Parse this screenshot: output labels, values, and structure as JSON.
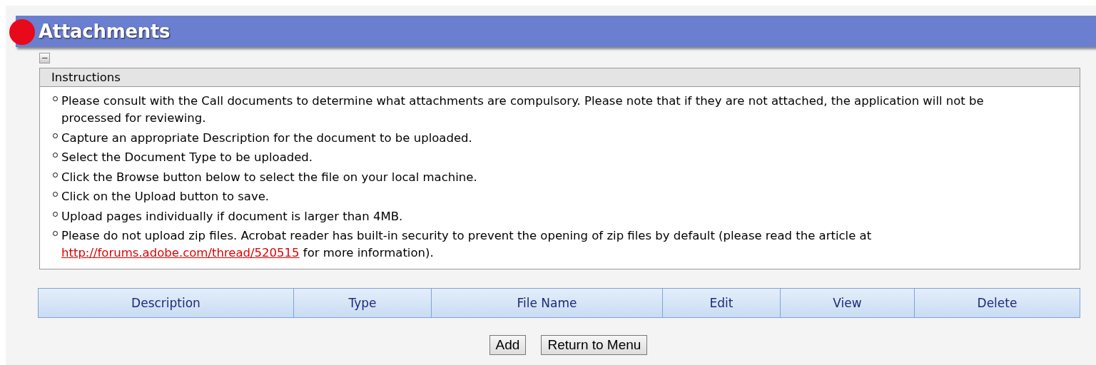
{
  "header": {
    "title": "Attachments"
  },
  "instructions": {
    "collapse_label": "−",
    "title": "Instructions",
    "items": [
      {
        "text": "Please consult with the Call documents to determine what attachments are compulsory. Please note that if they are not attached, the application will not be processed for reviewing."
      },
      {
        "text": "Capture an appropriate Description for the document to be uploaded."
      },
      {
        "text": "Select the Document Type to be uploaded."
      },
      {
        "text": "Click the Browse button below to select the file on your local machine."
      },
      {
        "text": "Click on the Upload button to save."
      },
      {
        "text": "Upload pages individually if document is larger than 4MB."
      },
      {
        "text": "Please do not upload zip files. Acrobat reader has built-in security to prevent the opening of zip files by default (please read the article at",
        "link": "http://forums.adobe.com/thread/520515",
        "after": "for more information)."
      }
    ]
  },
  "table": {
    "columns": [
      "Description",
      "Type",
      "File Name",
      "Edit",
      "View",
      "Delete"
    ]
  },
  "buttons": [
    "Add",
    "Return to Menu"
  ]
}
